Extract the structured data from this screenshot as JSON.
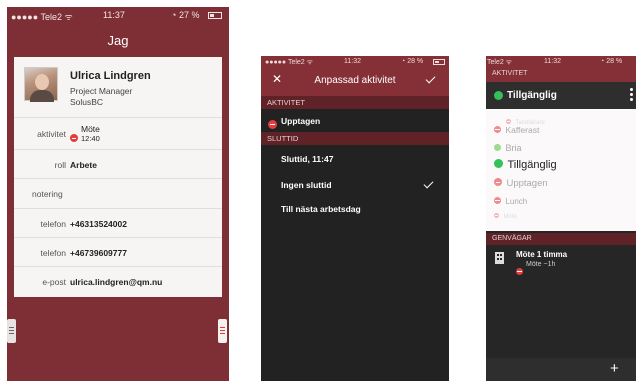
{
  "screen1": {
    "status": {
      "carrier": "●●●●● Tele2 ᯤ",
      "time": "11:37",
      "battery": "27 %"
    },
    "title": "Jag",
    "profile": {
      "name": "Ulrica Lindgren",
      "role_title": "Project Manager",
      "company": "SolusBC"
    },
    "fields": [
      {
        "label": "aktivitet",
        "value": "Möte",
        "sub": "12:40"
      },
      {
        "label": "roll",
        "value": "Arbete"
      },
      {
        "label": "notering",
        "value": ""
      },
      {
        "label": "telefon",
        "value": "+46313524002"
      },
      {
        "label": "telefon",
        "value": "+46739609777"
      },
      {
        "label": "e-post",
        "value": "ulrica.lindgren@qm.nu"
      }
    ]
  },
  "screen2": {
    "status": {
      "carrier": "●●●●● Tele2 ᯤ",
      "time": "11:32",
      "battery": "28 %"
    },
    "title": "Anpassad aktivitet",
    "sections": {
      "activity": "AKTIVITET",
      "end": "SLUTTID"
    },
    "activity_value": "Upptagen",
    "end_items": [
      "Sluttid,  11:47",
      "Ingen sluttid",
      "Till nästa arbetsdag"
    ]
  },
  "screen3": {
    "status": {
      "carrier": "Tele2 ᯤ",
      "time": "11:32",
      "battery": "28 %"
    },
    "section_activity": "AKTIVITET",
    "current": "Tillgänglig",
    "picker": [
      {
        "label": "Tandläkare",
        "color": "#e66",
        "size": 6
      },
      {
        "label": "Kafferast",
        "color": "#e66",
        "size": 8.5
      },
      {
        "label": "Bria",
        "color": "#7bd36a",
        "size": 9
      },
      {
        "label": "Tillgänglig",
        "color": "#34c159",
        "size": 11
      },
      {
        "label": "Upptagen",
        "color": "#e66",
        "size": 9.5
      },
      {
        "label": "Lunch",
        "color": "#e66",
        "size": 8
      },
      {
        "label": "Möte",
        "color": "#e66",
        "size": 6
      }
    ],
    "section_shortcuts": "GENVÄGAR",
    "shortcut": {
      "title": "Möte 1 timma",
      "sub": "Möte ~1h"
    },
    "fab": "+"
  },
  "colors": {
    "accent": "#843036",
    "available": "#34c159",
    "busy": "#e43d3d"
  }
}
